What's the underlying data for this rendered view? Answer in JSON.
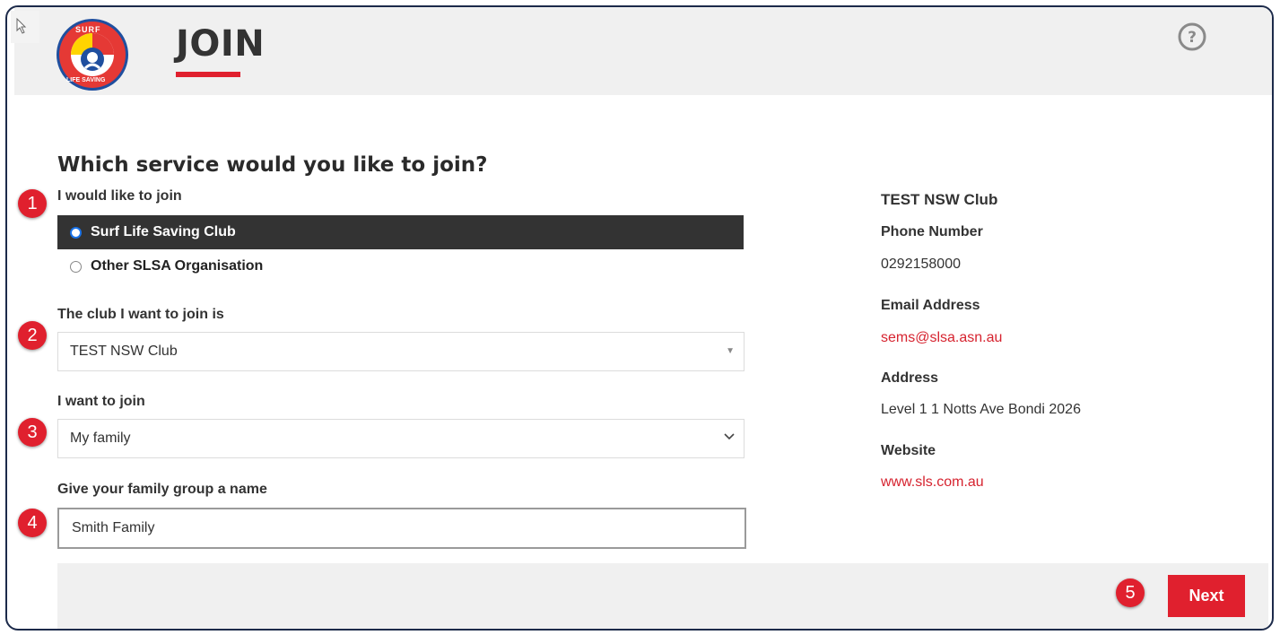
{
  "header": {
    "logo_text_top": "SURF",
    "logo_text_bottom": "LIFE SAVING",
    "title": "JOIN"
  },
  "form": {
    "question": "Which service would you like to join?",
    "join_type_label": "I would like to join",
    "join_options": [
      {
        "label": "Surf Life Saving Club",
        "selected": true
      },
      {
        "label": "Other SLSA Organisation",
        "selected": false
      }
    ],
    "club_label": "The club I want to join is",
    "club_value": "TEST NSW Club",
    "join_who_label": "I want to join",
    "join_who_value": "My family",
    "family_name_label": "Give your family group a name",
    "family_name_value": "Smith Family"
  },
  "club_info": {
    "name": "TEST NSW Club",
    "phone_label": "Phone Number",
    "phone": "0292158000",
    "email_label": "Email Address",
    "email": "sems@slsa.asn.au",
    "address_label": "Address",
    "address": "Level 1 1 Notts Ave Bondi 2026",
    "website_label": "Website",
    "website": "www.sls.com.au"
  },
  "footer": {
    "next_label": "Next"
  },
  "steps": [
    "1",
    "2",
    "3",
    "4",
    "5"
  ],
  "colors": {
    "accent": "#e0202e",
    "link": "#d6232f",
    "header_bg": "#f0f0f0",
    "selected_bg": "#333333"
  }
}
